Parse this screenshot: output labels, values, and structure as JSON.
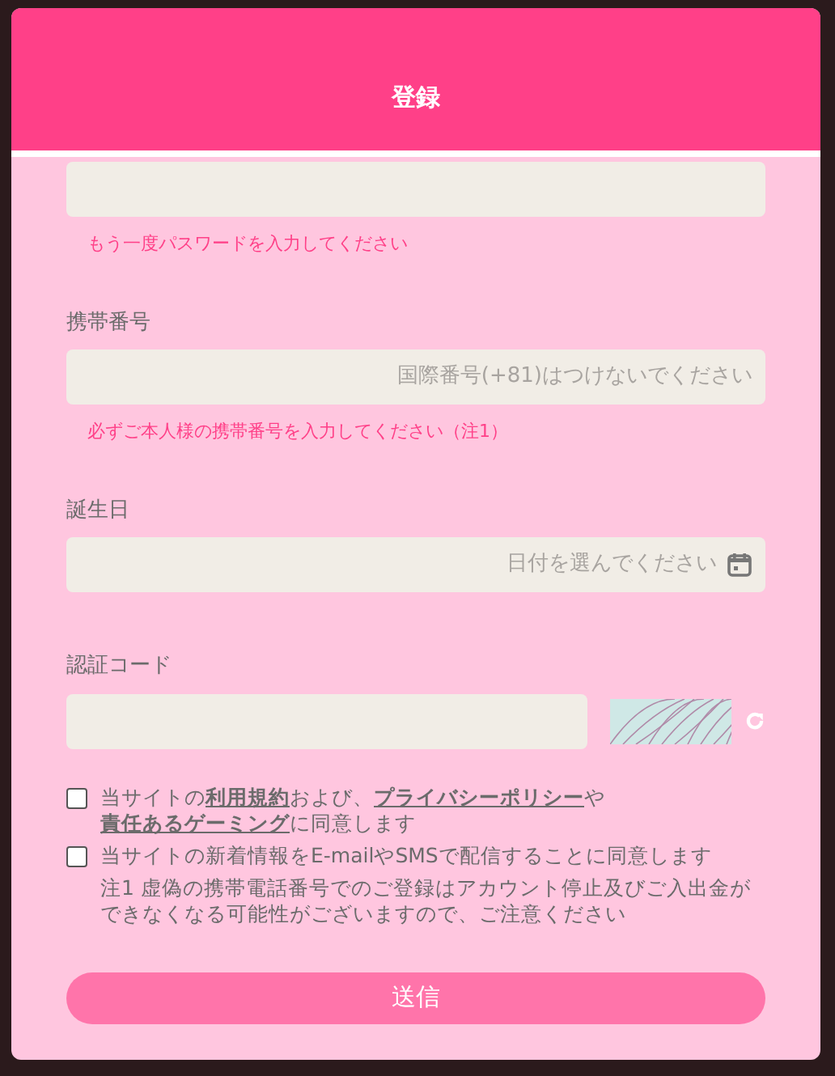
{
  "modal": {
    "title": "登録"
  },
  "fields": [
    {
      "kind": "text",
      "hint": "もう一度パスワードを入力してください"
    },
    {
      "kind": "text",
      "label": "携帯番号",
      "placeholder": "国際番号(+81)はつけないでください",
      "hint": "必ずご本人様の携帯番号を入力してください（注1）"
    },
    {
      "kind": "date",
      "label": "誕生日",
      "placeholder": "日付を選んでください"
    },
    {
      "kind": "captcha",
      "label": "認証コード"
    }
  ],
  "agreements": [
    {
      "checked": false,
      "parts": [
        {
          "kind": "text",
          "text": "当サイトの"
        },
        {
          "kind": "link",
          "text": "利用規約"
        },
        {
          "kind": "text",
          "text": "および、"
        },
        {
          "kind": "link",
          "text": "プライバシーポリシー"
        },
        {
          "kind": "text",
          "text": "や"
        },
        {
          "kind": "link",
          "text": "責任あるゲーミング"
        },
        {
          "kind": "text",
          "text": "に同意します"
        }
      ]
    },
    {
      "checked": false,
      "parts": [
        {
          "kind": "text",
          "text": "当サイトの新着情報をE-mailやSMSで配信することに同意します"
        }
      ]
    }
  ],
  "note": "注1 虚偽の携帯電話番号でのご登録はアカウント停止及びご入出金ができなくなる可能性がございますので、ご注意ください",
  "submit": "送信"
}
